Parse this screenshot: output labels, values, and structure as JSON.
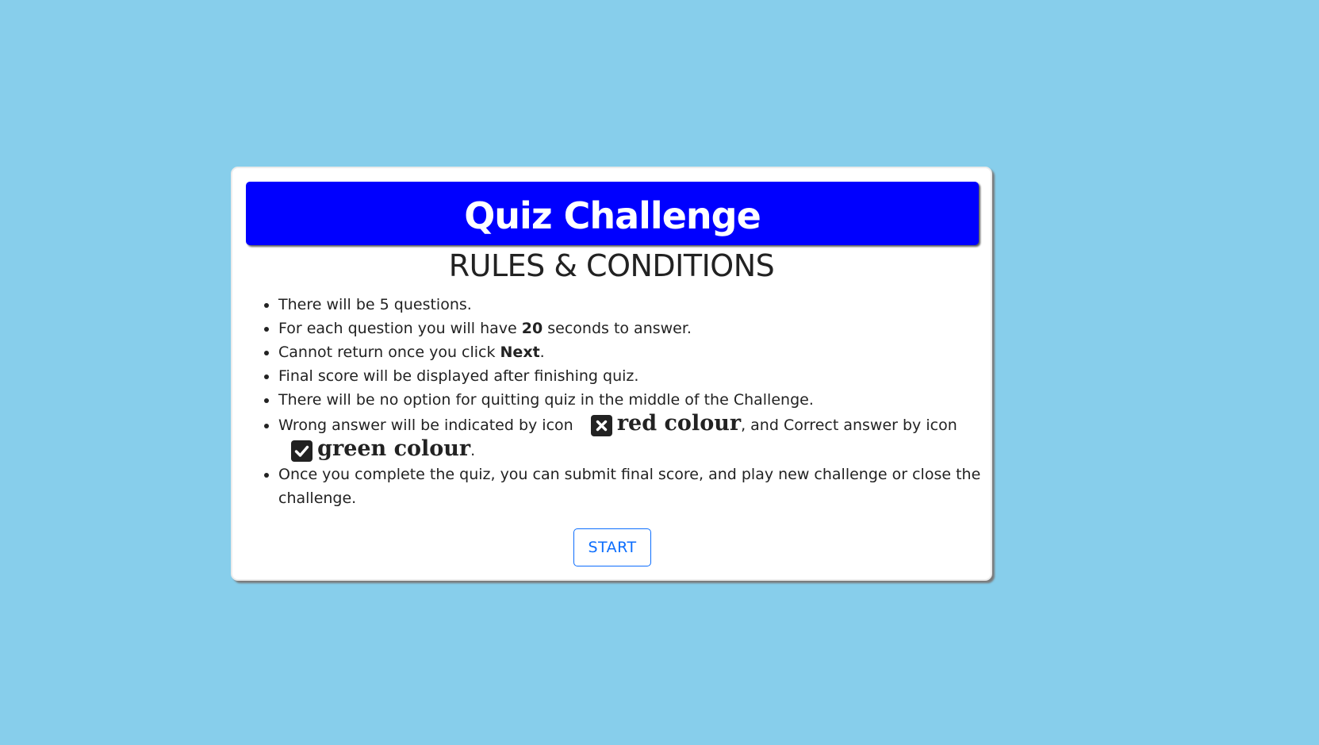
{
  "header": {
    "title": "Quiz Challenge"
  },
  "rules_section": {
    "heading": "RULES & CONDITIONS",
    "rule1": "There will be 5 questions.",
    "rule2": {
      "before": "For each question you will have ",
      "seconds": "20",
      "after": " seconds to answer."
    },
    "rule3": {
      "before": "Cannot return once you click ",
      "next": "Next",
      "after": "."
    },
    "rule4": "Final score will be displayed after finishing quiz.",
    "rule5": "There will be no option for quitting quiz in the middle of the Challenge.",
    "rule6": {
      "wrong_prefix": "Wrong answer will be indicated by icon",
      "wrong_icon": "square-x-icon",
      "wrong_colour": "red colour",
      "middle": ", and Correct answer by icon",
      "correct_icon": "square-check-icon",
      "correct_colour": "green colour",
      "end": "."
    },
    "rule7": "Once you complete the quiz, you can submit final score, and play new challenge or close the challenge."
  },
  "start_button": {
    "label": "START"
  },
  "colors": {
    "background": "#87ceeb",
    "banner": "#0000ff",
    "card": "#ffffff",
    "button_accent": "#0d6efd"
  }
}
